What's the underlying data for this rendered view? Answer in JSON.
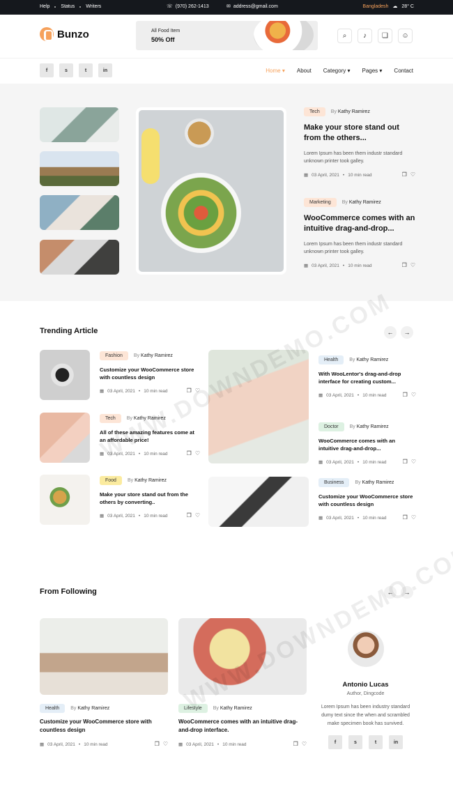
{
  "topbar": {
    "links": [
      "Help",
      "Status",
      "Writers"
    ],
    "phone": "(970) 262-1413",
    "email": "address@gmail.com",
    "location": "Bangladesh",
    "temperature": "28° C"
  },
  "header": {
    "logo": "Bunzo",
    "promo_line1": "All Food Item",
    "promo_line2": "50% Off"
  },
  "social": [
    "f",
    "s",
    "t",
    "in"
  ],
  "menu": [
    "Home",
    "About",
    "Category",
    "Pages",
    "Contact"
  ],
  "hero_posts": [
    {
      "tag": "Tech",
      "author_prefix": "By",
      "author": "Kathy Ramirez",
      "title": "Make your store stand out from the others...",
      "desc": "Lorem Ipsum has been them industr standard unknown printer took galley.",
      "date": "03 April, 2021",
      "read": "10 min read"
    },
    {
      "tag": "Marketing",
      "author_prefix": "By",
      "author": "Kathy Ramirez",
      "title": "WooCommerce comes with an intuitive drag-and-drop...",
      "desc": "Lorem Ipsum has been them industr standard unknown printer took galley.",
      "date": "03 April, 2021",
      "read": "10 min read"
    }
  ],
  "trending": {
    "title": "Trending Article",
    "left": [
      {
        "tag": "Fashion",
        "author": "Kathy Ramirez",
        "title": "Customize your WooCommerce store with countless design",
        "date": "03 April, 2021",
        "read": "10 min read"
      },
      {
        "tag": "Tech",
        "author": "Kathy Ramirez",
        "title": "All of these amazing features come at an affordable price!",
        "date": "03 April, 2021",
        "read": "10 min read"
      },
      {
        "tag": "Food",
        "author": "Kathy Ramirez",
        "title": "Make your store stand out from the others by converting..",
        "date": "03 April, 2021",
        "read": "10 min read"
      }
    ],
    "right": [
      {
        "tag": "Health",
        "author": "Kathy Ramirez",
        "title": "With WooLentor's drag-and-drop interface for creating custom...",
        "date": "03 April, 2021",
        "read": "10 min read"
      },
      {
        "tag": "Doctor",
        "author": "Kathy Ramirez",
        "title": "WooCommerce comes with an intuitive drag-and-drop...",
        "date": "03 April, 2021",
        "read": "10 min read"
      },
      {
        "tag": "Business",
        "author": "Kathy Ramirez",
        "title": "Customize your WooCommerce store with countless design",
        "date": "03 April, 2021",
        "read": "10 min read"
      }
    ]
  },
  "following": {
    "title": "From Following",
    "cards": [
      {
        "tag": "Health",
        "author": "Kathy Ramirez",
        "title": "Customize your WooCommerce store with countless design",
        "date": "03 April, 2021",
        "read": "10 min read"
      },
      {
        "tag": "Lifestyle",
        "author": "Kathy Ramirez",
        "title": "WooCommerce comes with an intuitive drag-and-drop interface.",
        "date": "03 April, 2021",
        "read": "10 min read"
      }
    ],
    "author": {
      "name": "Antonio Lucas",
      "role": "Author, Dingcode",
      "bio": "Lorem Ipsum has been industry standard dumy text since the when and scrambled make specimen book has survived."
    }
  },
  "watermark": "WWW.DOWNDEMO.COM",
  "colors": {
    "accent": "#f6a15b",
    "topbar": "#15181d",
    "hero_bg": "#f5f5f5"
  }
}
